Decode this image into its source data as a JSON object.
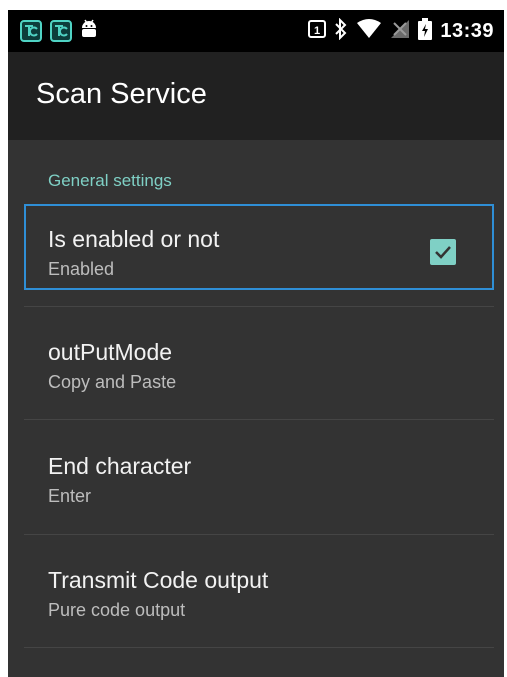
{
  "status_bar": {
    "time": "13:39",
    "left_icons": [
      "tc-app-icon",
      "tc-app-icon",
      "android-debug-icon"
    ],
    "right_icons": [
      "sim-icon",
      "bluetooth-icon",
      "wifi-icon",
      "no-signal-icon",
      "battery-icon"
    ]
  },
  "app_bar": {
    "title": "Scan Service"
  },
  "settings": {
    "section_header": "General settings",
    "items": [
      {
        "title": "Is enabled or not",
        "summary": "Enabled",
        "checked": true
      },
      {
        "title": "outPutMode",
        "summary": "Copy and Paste"
      },
      {
        "title": "End character",
        "summary": "Enter"
      },
      {
        "title": "Transmit Code output",
        "summary": "Pure code output"
      }
    ]
  },
  "colors": {
    "accent": "#7fd0c5",
    "focus_border": "#2f8fd6",
    "background": "#333333",
    "app_bar": "#212121",
    "status_bar": "#000000"
  }
}
